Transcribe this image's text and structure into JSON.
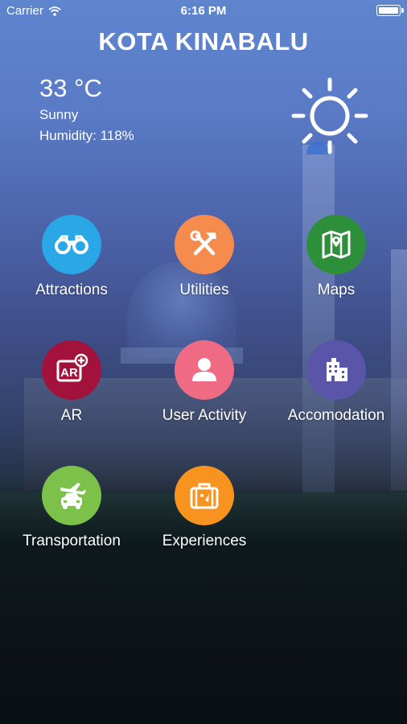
{
  "status_bar": {
    "carrier": "Carrier",
    "time": "6:16 PM"
  },
  "header": {
    "title": "KOTA KINABALU"
  },
  "weather": {
    "temperature": "33 °C",
    "condition": "Sunny",
    "humidity": "Humidity: 118%",
    "icon": "sun-icon"
  },
  "menu": {
    "items": [
      {
        "label": "Attractions",
        "icon": "binoculars-icon",
        "color": "#2aa7e6"
      },
      {
        "label": "Utilities",
        "icon": "tools-icon",
        "color": "#f58c4e"
      },
      {
        "label": "Maps",
        "icon": "map-icon",
        "color": "#2e8f3a"
      },
      {
        "label": "AR",
        "icon": "ar-icon",
        "color": "#a3123c"
      },
      {
        "label": "User Activity",
        "icon": "user-icon",
        "color": "#ef6b84"
      },
      {
        "label": "Accomodation",
        "icon": "building-icon",
        "color": "#5a55a8"
      },
      {
        "label": "Transportation",
        "icon": "transport-icon",
        "color": "#7cc24a"
      },
      {
        "label": "Experiences",
        "icon": "suitcase-icon",
        "color": "#f7931e"
      }
    ]
  }
}
